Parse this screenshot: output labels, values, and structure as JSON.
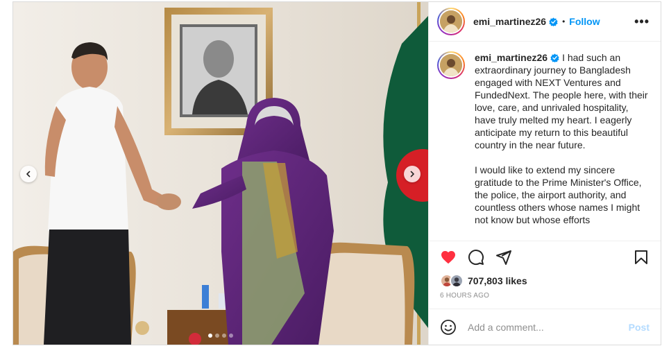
{
  "post": {
    "username": "emi_martinez26",
    "verified": true,
    "follow_label": "Follow",
    "separator": "•",
    "more_label": "•••",
    "caption_paragraphs": [
      "I had such an extraordinary journey to Bangladesh engaged with NEXT Ventures and FundedNext. The people here, with their love, care, and unrivaled hospitality, have truly melted my heart. I eagerly anticipate my return to this beautiful country in the near future.",
      "I would like to extend my sincere gratitude to the Prime Minister's Office, the police, the airport authority, and countless others whose names I might not know but whose efforts"
    ],
    "likes": "707,803 likes",
    "time": "6 HOURS AGO",
    "liked": true,
    "comment_placeholder": "Add a comment...",
    "post_label": "Post",
    "carousel": {
      "slides": 4,
      "active_index": 0
    },
    "icons": {
      "prev": "chevron-left-icon",
      "next": "chevron-right-icon",
      "like": "heart-icon",
      "comment": "comment-icon",
      "share": "send-icon",
      "save": "bookmark-icon",
      "emoji": "emoji-icon",
      "more": "more-icon",
      "verified": "verified-badge-icon"
    },
    "colors": {
      "link": "#0095f6",
      "like": "#ff3040",
      "post_disabled": "#b3dbff",
      "muted": "#8e8e8e",
      "verified": "#0095f6"
    }
  }
}
